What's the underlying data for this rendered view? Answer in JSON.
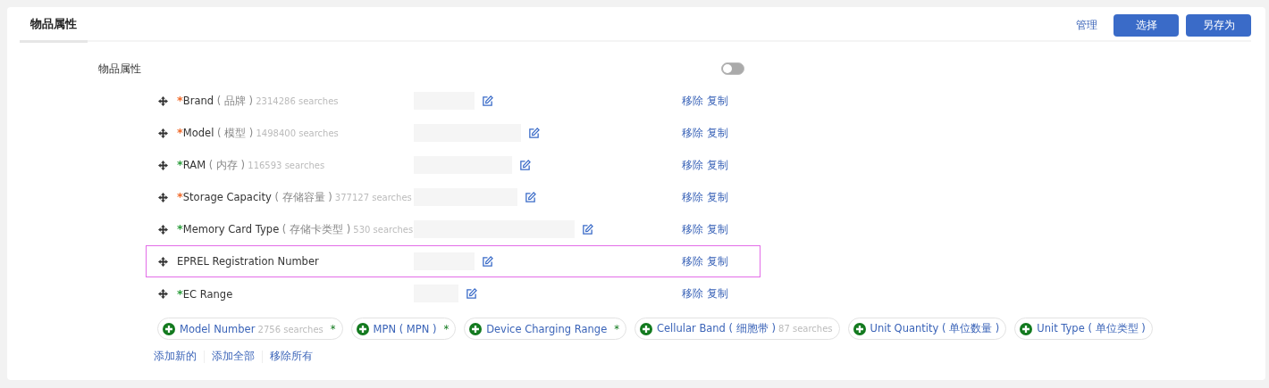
{
  "tabs": [
    {
      "label": "物品属性",
      "selected": true
    }
  ],
  "header_actions": {
    "link": "管理",
    "buttons": [
      "选择",
      "另存为"
    ]
  },
  "section": {
    "label": "物品属性",
    "toggle_on": false
  },
  "rows": [
    {
      "marker": "*",
      "color": "#f06a2a",
      "name": "Brand",
      "zh": "( 品牌 )",
      "searches": "2314286 searches",
      "highlighted": false,
      "actions": [
        "移除",
        "复制"
      ]
    },
    {
      "marker": "*",
      "color": "#f06a2a",
      "name": "Model",
      "zh": "( 模型 )",
      "searches": "1498400 searches",
      "highlighted": false,
      "actions": [
        "移除",
        "复制"
      ]
    },
    {
      "marker": "*",
      "color": "#2e9e3e",
      "name": "RAM",
      "zh": "( 内存 )",
      "searches": "116593 searches",
      "highlighted": false,
      "actions": [
        "移除",
        "复制"
      ]
    },
    {
      "marker": "*",
      "color": "#f06a2a",
      "name": "Storage Capacity",
      "zh": "( 存储容量 )",
      "searches": "377127 searches",
      "highlighted": false,
      "actions": [
        "移除",
        "复制"
      ]
    },
    {
      "marker": "*",
      "color": "#2e9e3e",
      "name": "Memory Card Type",
      "zh": "( 存储卡类型 )",
      "searches": "530 searches",
      "highlighted": false,
      "actions": [
        "移除",
        "复制"
      ]
    },
    {
      "name": "EPREL Registration Number",
      "highlighted": true,
      "actions": [
        "移除",
        "复制"
      ]
    },
    {
      "marker": "*",
      "color": "#2e9e3e",
      "name": "EC Range",
      "highlighted": false,
      "actions": [
        "移除",
        "复制"
      ]
    }
  ],
  "suggestions": [
    {
      "name": "Model Number",
      "searches": "2756 searches",
      "star": "*"
    },
    {
      "name": "MPN",
      "zh": "( MPN )",
      "star": "*"
    },
    {
      "name": "Device Charging Range",
      "star": "*"
    },
    {
      "name": "Cellular Band",
      "zh": "( 细胞带 )",
      "searches": "87 searches"
    },
    {
      "name": "Unit Quantity",
      "zh": "( 单位数量 )"
    },
    {
      "name": "Unit Type",
      "zh": "( 单位类型 )"
    }
  ],
  "footer_links": [
    "添加新的",
    "添加全部",
    "移除所有"
  ]
}
